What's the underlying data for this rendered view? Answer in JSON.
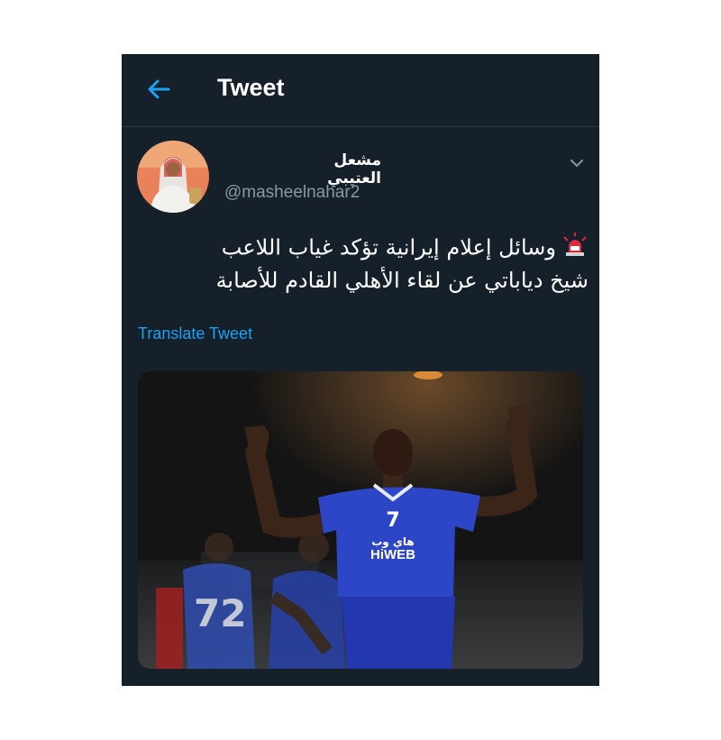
{
  "header": {
    "title": "Tweet",
    "back_icon": "arrow-left-icon"
  },
  "author": {
    "name": "مشعل العتيبي",
    "handle": "@masheelnahar2"
  },
  "tweet": {
    "emoji": "rotating-light-icon",
    "line1": "وسائل إعلام إيرانية تؤكد غياب اللاعب",
    "line2": "شيخ دياباتي عن لقاء الأهلي القادم للأصابة"
  },
  "translate_label": "Translate Tweet",
  "media": {
    "jersey_number": "7",
    "sponsor_arabic": "هاي وب",
    "sponsor": "HiWEB",
    "background_player_number": "72"
  },
  "colors": {
    "background": "#15202b",
    "accent": "#1da1f2",
    "secondary_text": "#8899a6"
  }
}
